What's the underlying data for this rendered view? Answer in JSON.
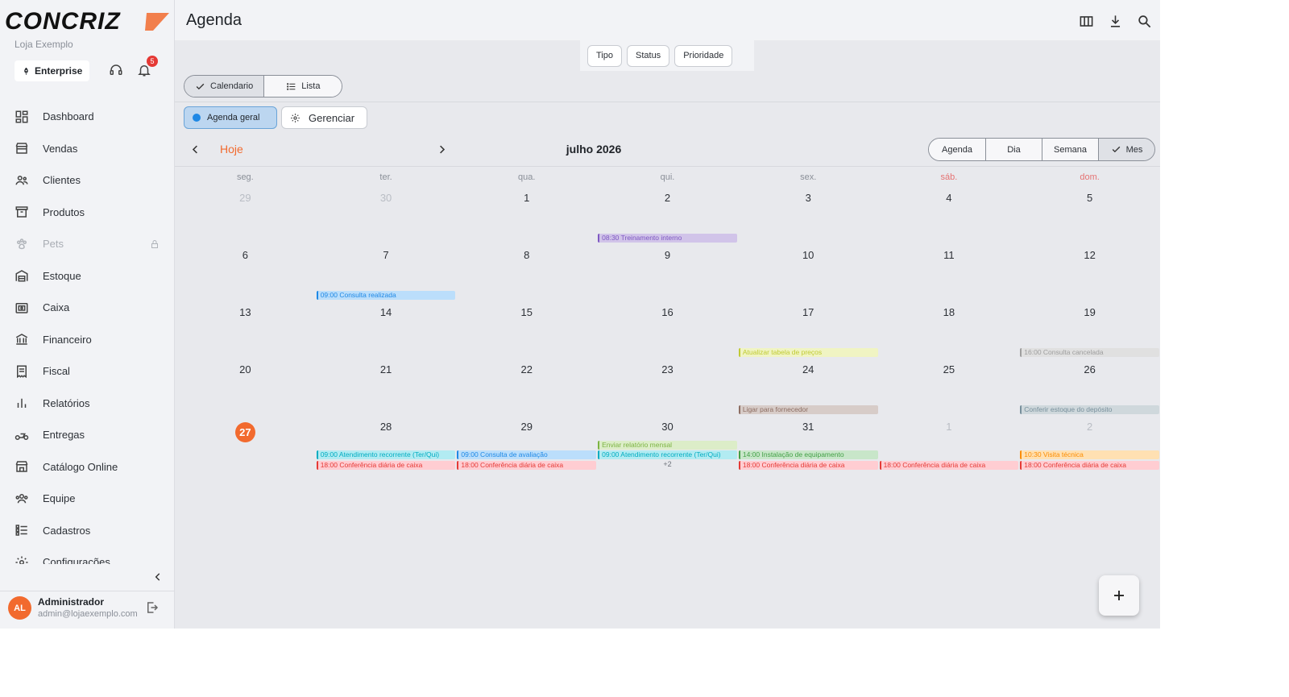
{
  "brand": {
    "logo_text": "CONCRIZ"
  },
  "store": {
    "name": "Loja Exemplo"
  },
  "plan": {
    "label": "Enterprise"
  },
  "notifications": {
    "count": "5"
  },
  "nav": [
    {
      "label": "Dashboard",
      "icon": "dashboard-icon"
    },
    {
      "label": "Vendas",
      "icon": "store-icon"
    },
    {
      "label": "Clientes",
      "icon": "people-icon"
    },
    {
      "label": "Produtos",
      "icon": "archive-icon"
    },
    {
      "label": "Pets",
      "icon": "paw-icon",
      "locked": true
    },
    {
      "label": "Estoque",
      "icon": "warehouse-icon"
    },
    {
      "label": "Caixa",
      "icon": "cash-register-icon"
    },
    {
      "label": "Financeiro",
      "icon": "bank-icon"
    },
    {
      "label": "Fiscal",
      "icon": "receipt-icon"
    },
    {
      "label": "Relatórios",
      "icon": "bar-chart-icon"
    },
    {
      "label": "Entregas",
      "icon": "motorcycle-icon"
    },
    {
      "label": "Catálogo Online",
      "icon": "storefront-icon"
    },
    {
      "label": "Equipe",
      "icon": "team-icon"
    },
    {
      "label": "Cadastros",
      "icon": "grid-list-icon"
    },
    {
      "label": "Configurações",
      "icon": "gear-icon"
    }
  ],
  "user": {
    "initials": "AL",
    "name": "Administrador",
    "email": "admin@lojaexemplo.com"
  },
  "header": {
    "title": "Agenda"
  },
  "filters": {
    "tipo": "Tipo",
    "status": "Status",
    "prioridade": "Prioridade"
  },
  "view_toggle": {
    "calendar": "Calendario",
    "list": "Lista",
    "active": "calendar"
  },
  "agenda_chip": {
    "label": "Agenda geral",
    "color": "#1e88e5"
  },
  "manage": {
    "label": "Gerenciar"
  },
  "toolbar": {
    "today": "Hoje",
    "month_title": "julho 2026"
  },
  "ranges": [
    {
      "label": "Agenda",
      "active": false
    },
    {
      "label": "Dia",
      "active": false
    },
    {
      "label": "Semana",
      "active": false
    },
    {
      "label": "Mes",
      "active": true
    }
  ],
  "calendar": {
    "weekdays": [
      "seg.",
      "ter.",
      "qua.",
      "qui.",
      "sex.",
      "sáb.",
      "dom."
    ],
    "weeks": [
      [
        {
          "d": "29",
          "other": true
        },
        {
          "d": "30",
          "other": true
        },
        {
          "d": "1"
        },
        {
          "d": "2"
        },
        {
          "d": "3"
        },
        {
          "d": "4"
        },
        {
          "d": "5"
        }
      ],
      [
        {
          "d": "6"
        },
        {
          "d": "7"
        },
        {
          "d": "8"
        },
        {
          "d": "9"
        },
        {
          "d": "10"
        },
        {
          "d": "11"
        },
        {
          "d": "12"
        }
      ],
      [
        {
          "d": "13"
        },
        {
          "d": "14"
        },
        {
          "d": "15"
        },
        {
          "d": "16"
        },
        {
          "d": "17"
        },
        {
          "d": "18"
        },
        {
          "d": "19"
        }
      ],
      [
        {
          "d": "20"
        },
        {
          "d": "21"
        },
        {
          "d": "22"
        },
        {
          "d": "23"
        },
        {
          "d": "24"
        },
        {
          "d": "25"
        },
        {
          "d": "26"
        }
      ],
      [
        {
          "d": "27",
          "today": true
        },
        {
          "d": "28"
        },
        {
          "d": "29"
        },
        {
          "d": "30"
        },
        {
          "d": "31"
        },
        {
          "d": "1",
          "other": true
        },
        {
          "d": "2",
          "other": true
        }
      ]
    ],
    "events": [
      {
        "week": 0,
        "day": 3,
        "slot": "bottom0",
        "text": "08:30 Treinamento interno",
        "color": "#7e57c2",
        "bg": "#d1c4e9"
      },
      {
        "week": 1,
        "day": 1,
        "slot": "bottom0",
        "text": "09:00 Consulta realizada",
        "color": "#1e88e5",
        "bg": "#bbdefb"
      },
      {
        "week": 2,
        "day": 4,
        "slot": "bottom0",
        "text": "Atualizar tabela de preços",
        "color": "#c0ca33",
        "bg": "#f0f4c3"
      },
      {
        "week": 2,
        "day": 6,
        "slot": "bottom0",
        "text": "16:00 Consulta cancelada",
        "color": "#9e9e9e",
        "bg": "#e0e0e0"
      },
      {
        "week": 3,
        "day": 4,
        "slot": "bottom0",
        "text": "Ligar para fornecedor",
        "color": "#8d6e63",
        "bg": "#d7ccc8"
      },
      {
        "week": 3,
        "day": 6,
        "slot": "bottom0",
        "text": "Conferir estoque do depósito",
        "color": "#78909c",
        "bg": "#cfd8dc"
      },
      {
        "week": 4,
        "day": 3,
        "slot": "r0",
        "text": "Enviar relatório mensal",
        "color": "#7cb342",
        "bg": "#dcedc8"
      },
      {
        "week": 4,
        "day": 1,
        "slot": "r1",
        "text": "09:00 Atendimento recorrente (Ter/Qui)",
        "color": "#00acc1",
        "bg": "#b2ebf2"
      },
      {
        "week": 4,
        "day": 2,
        "slot": "r1",
        "text": "09:00 Consulta de avaliação",
        "color": "#1e88e5",
        "bg": "#bbdefb"
      },
      {
        "week": 4,
        "day": 3,
        "slot": "r1",
        "text": "09:00 Atendimento recorrente (Ter/Qui)",
        "color": "#00acc1",
        "bg": "#b2ebf2"
      },
      {
        "week": 4,
        "day": 4,
        "slot": "r1",
        "text": "14:00 Instalação de equipamento",
        "color": "#43a047",
        "bg": "#c8e6c9"
      },
      {
        "week": 4,
        "day": 6,
        "slot": "r1",
        "text": "10:30 Visita técnica",
        "color": "#fb8c00",
        "bg": "#ffe0b2"
      },
      {
        "week": 4,
        "day": 1,
        "slot": "r2",
        "text": "18:00 Conferência diária de caixa",
        "color": "#e53935",
        "bg": "#ffcdd2"
      },
      {
        "week": 4,
        "day": 2,
        "slot": "r2",
        "text": "18:00 Conferência diária de caixa",
        "color": "#e53935",
        "bg": "#ffcdd2"
      },
      {
        "week": 4,
        "day": 4,
        "slot": "r2",
        "text": "18:00 Conferência diária de caixa",
        "color": "#e53935",
        "bg": "#ffcdd2"
      },
      {
        "week": 4,
        "day": 5,
        "slot": "r2",
        "text": "18:00 Conferência diária de caixa",
        "color": "#e53935",
        "bg": "#ffcdd2"
      },
      {
        "week": 4,
        "day": 6,
        "slot": "r2",
        "text": "18:00 Conferência diária de caixa",
        "color": "#e53935",
        "bg": "#ffcdd2"
      }
    ],
    "more": [
      {
        "week": 4,
        "day": 3,
        "text": "+2"
      }
    ]
  },
  "fab": {
    "icon": "plus-icon"
  }
}
